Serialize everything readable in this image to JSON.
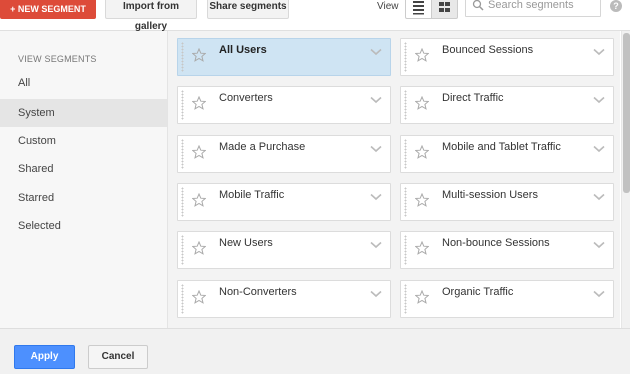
{
  "toolbar": {
    "new_segment_label": "+ NEW SEGMENT",
    "import_label": "Import from gallery",
    "share_label": "Share segments",
    "view_label": "View",
    "search_placeholder": "Search segments",
    "help_label": "?",
    "view_mode_selected": "grid"
  },
  "sidebar": {
    "heading": "VIEW SEGMENTS",
    "items": [
      {
        "label": "All",
        "active": false
      },
      {
        "label": "System",
        "active": true
      },
      {
        "label": "Custom",
        "active": false
      },
      {
        "label": "Shared",
        "active": false
      },
      {
        "label": "Starred",
        "active": false
      },
      {
        "label": "Selected",
        "active": false
      }
    ]
  },
  "segments": [
    {
      "label": "All Users",
      "selected": true,
      "starred": false
    },
    {
      "label": "Bounced Sessions",
      "selected": false,
      "starred": false
    },
    {
      "label": "Converters",
      "selected": false,
      "starred": false
    },
    {
      "label": "Direct Traffic",
      "selected": false,
      "starred": false
    },
    {
      "label": "Made a Purchase",
      "selected": false,
      "starred": false
    },
    {
      "label": "Mobile and Tablet Traffic",
      "selected": false,
      "starred": false
    },
    {
      "label": "Mobile Traffic",
      "selected": false,
      "starred": false
    },
    {
      "label": "Multi-session Users",
      "selected": false,
      "starred": false
    },
    {
      "label": "New Users",
      "selected": false,
      "starred": false
    },
    {
      "label": "Non-bounce Sessions",
      "selected": false,
      "starred": false
    },
    {
      "label": "Non-Converters",
      "selected": false,
      "starred": false
    },
    {
      "label": "Organic Traffic",
      "selected": false,
      "starred": false
    }
  ],
  "footer": {
    "apply_label": "Apply",
    "cancel_label": "Cancel"
  },
  "colors": {
    "new_segment_bg": "#dd4b39",
    "apply_bg": "#4d90fe",
    "selected_card_bg": "#cfe4f3"
  }
}
